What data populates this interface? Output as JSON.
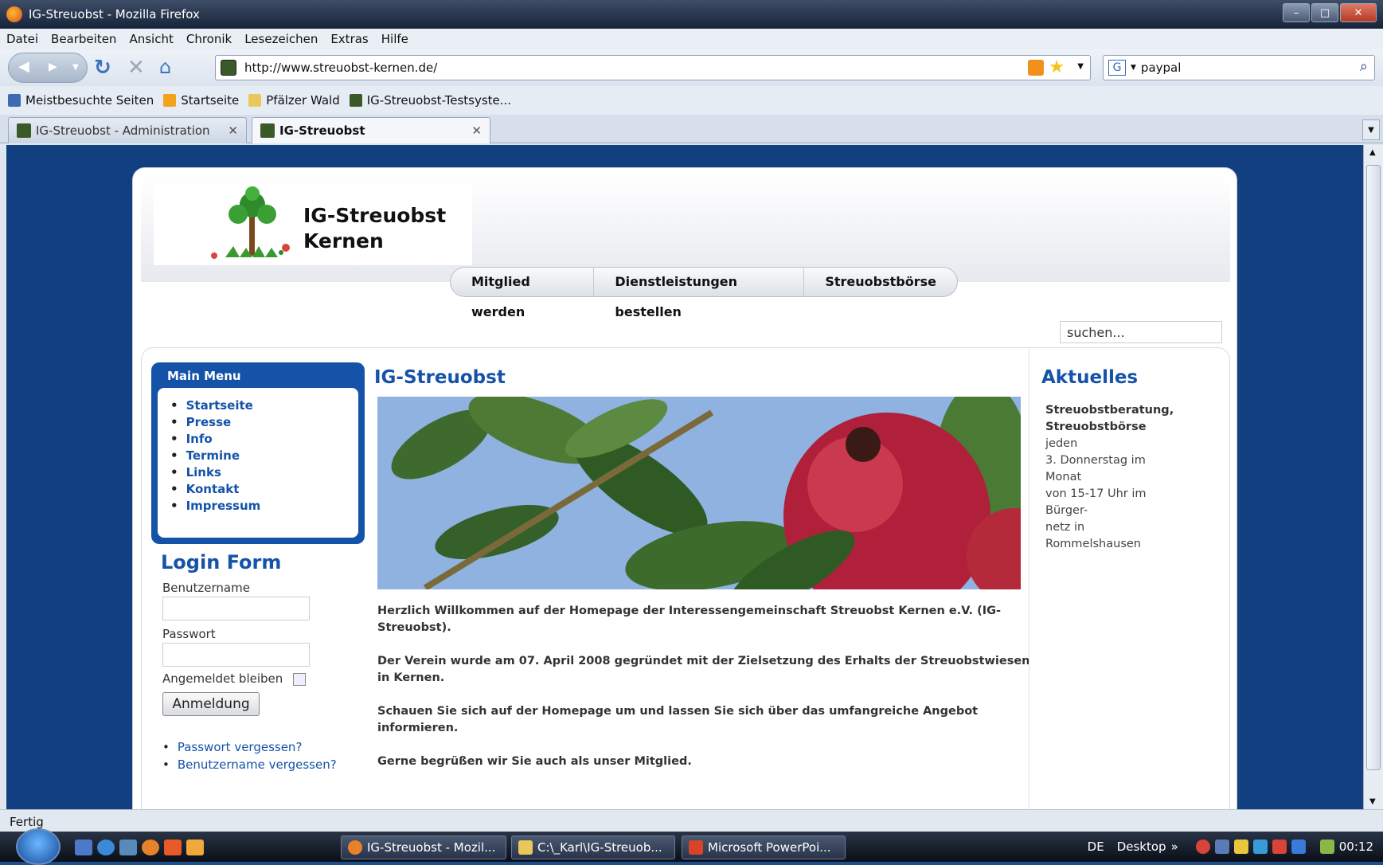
{
  "window": {
    "title": "IG-Streuobst - Mozilla Firefox"
  },
  "menu": [
    "Datei",
    "Bearbeiten",
    "Ansicht",
    "Chronik",
    "Lesezeichen",
    "Extras",
    "Hilfe"
  ],
  "nav": {
    "url": "http://www.streuobst-kernen.de/",
    "search_value": "paypal",
    "search_engine_icon": "google-icon"
  },
  "bookmarks": [
    {
      "label": "Meistbesuchte Seiten",
      "icon": "most-visited-icon",
      "color": "#3d6bb3"
    },
    {
      "label": "Startseite",
      "icon": "rss-icon",
      "color": "#f2a21b"
    },
    {
      "label": "Pfälzer Wald",
      "icon": "folder-icon",
      "color": "#e8c85a"
    },
    {
      "label": "IG-Streuobst-Testsyste...",
      "icon": "site-favicon",
      "color": "#3a5a2a"
    }
  ],
  "tabs": [
    {
      "label": "IG-Streuobst - Administration",
      "active": false
    },
    {
      "label": "IG-Streuobst",
      "active": true
    }
  ],
  "site": {
    "logo_line1": "IG-Streuobst",
    "logo_line2": "Kernen",
    "topnav": [
      "Mitglied werden",
      "Dienstleistungen bestellen",
      "Streuobstbörse"
    ],
    "search_placeholder": "suchen...",
    "main_menu_title": "Main Menu",
    "main_menu": [
      "Startseite",
      "Presse",
      "Info",
      "Termine",
      "Links",
      "Kontakt",
      "Impressum"
    ],
    "login_title": "Login Form",
    "username_label": "Benutzername",
    "password_label": "Passwort",
    "remember_label": "Angemeldet bleiben",
    "login_button": "Anmeldung",
    "forgot_password": "Passwort vergessen?",
    "forgot_username": "Benutzername vergessen?",
    "content_title": "IG-Streuobst",
    "paragraphs": [
      "Herzlich Willkommen auf der Homepage der Interessengemeinschaft Streuobst Kernen e.V. (IG-Streuobst).",
      "Der Verein wurde am 07. April 2008 gegründet mit der Zielsetzung des Erhalts der Streuobstwiesen in Kernen.",
      "Schauen Sie sich auf der Homepage um und lassen Sie sich über das umfangreiche Angebot informieren.",
      "Gerne begrüßen wir Sie auch als unser Mitglied."
    ],
    "news_title": "Aktuelles",
    "news_heading1": "Streuobstberatung,",
    "news_heading2": "Streuobstbörse",
    "news_lines": [
      "jeden",
      "3. Donnerstag im",
      "Monat",
      "von 15-17 Uhr im",
      "Bürger-",
      "netz in",
      "Rommelshausen"
    ]
  },
  "status": "Fertig",
  "taskbar": {
    "buttons": [
      "IG-Streuobst - Mozil...",
      "C:\\_Karl\\IG-Streuob...",
      "Microsoft PowerPoi..."
    ],
    "lang": "DE",
    "desktop": "Desktop",
    "chevron": "»",
    "clock": "00:12"
  },
  "colors": {
    "page_bg": "#123f80",
    "accent": "#1553a8"
  }
}
